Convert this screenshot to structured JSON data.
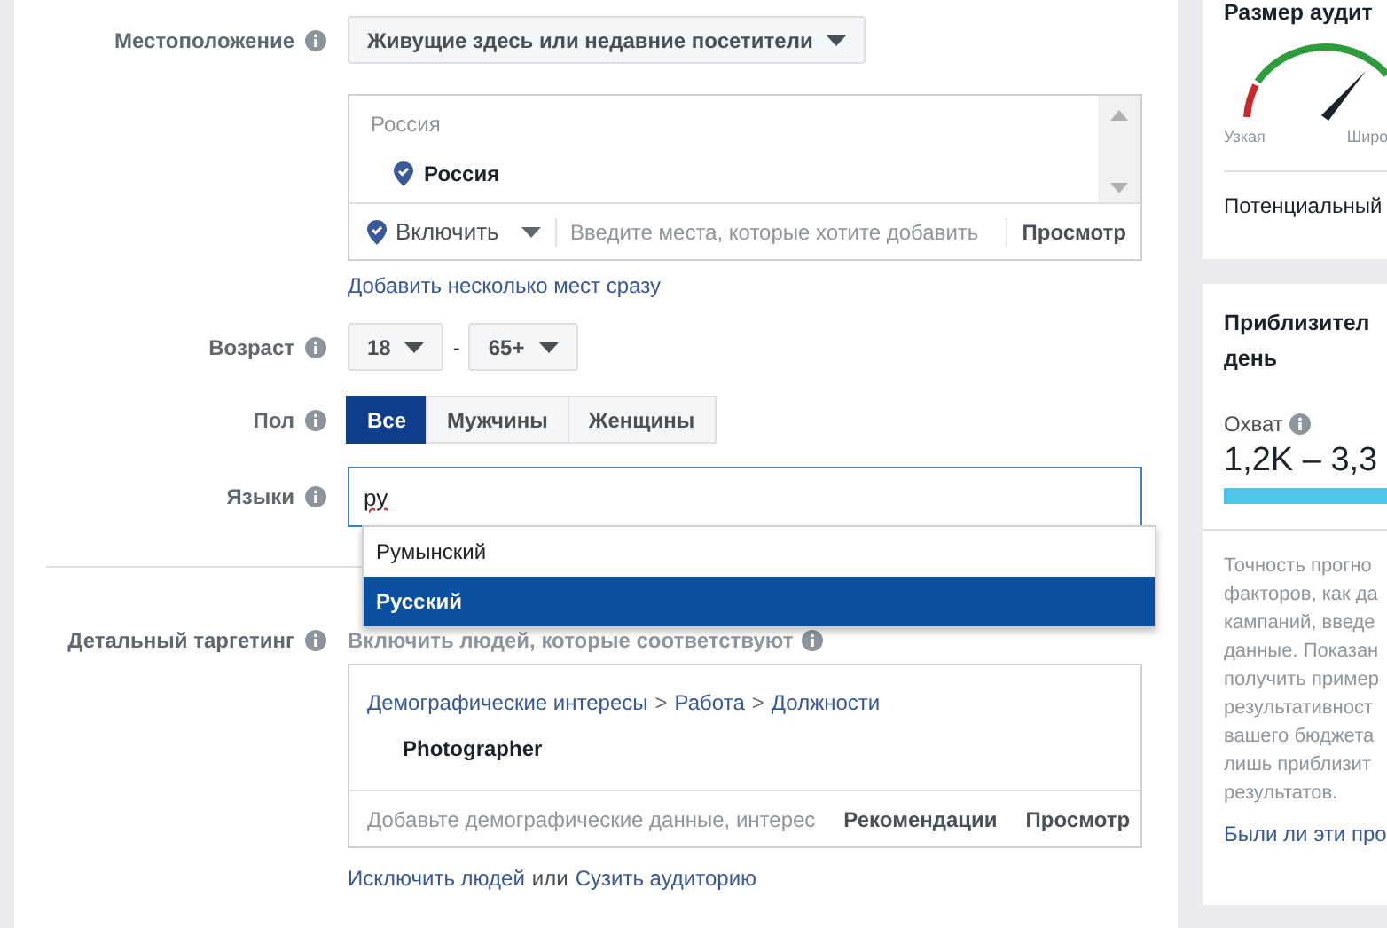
{
  "location": {
    "label": "Местоположение",
    "mode": "Живущие здесь или недавние посетители",
    "group_title": "Россия",
    "places": [
      {
        "name": "Россия"
      }
    ],
    "include": "Включить",
    "placeholder": "Введите места, которые хотите добавить",
    "browse": "Просмотр",
    "bulk_link": "Добавить несколько мест сразу"
  },
  "age": {
    "label": "Возраст",
    "min": "18",
    "separator": "-",
    "max": "65+"
  },
  "gender": {
    "label": "Пол",
    "options": [
      {
        "label": "Все",
        "selected": true
      },
      {
        "label": "Мужчины",
        "selected": false
      },
      {
        "label": "Женщины",
        "selected": false
      }
    ]
  },
  "languages": {
    "label": "Языки",
    "value": "ру",
    "suggestions": [
      {
        "label": "Румынский",
        "selected": false
      },
      {
        "label": "Русский",
        "selected": true
      }
    ]
  },
  "detailed": {
    "label": "Детальный таргетинг",
    "caption": "Включить людей, которые соответствуют",
    "path": [
      "Демографические интересы",
      "Работа",
      "Должности"
    ],
    "path_separator": ">",
    "item": "Photographer",
    "placeholder": "Добавьте демографические данные, интерес",
    "suggestions": "Рекомендации",
    "browse": "Просмотр",
    "exclude_link": "Исключить людей",
    "or": "или",
    "narrow_link": "Сузить аудиторию"
  },
  "audience_size": {
    "title": "Размер аудит",
    "narrow": "Узкая",
    "broad": "Широ",
    "potential": "Потенциальный"
  },
  "estimate": {
    "title_lines": [
      "Приблизител",
      "день"
    ],
    "reach_label": "Охват",
    "reach": "1,2K – 3,3",
    "note_lines": [
      "Точность прогно",
      "факторов, как да",
      "кампаний, введе",
      "данные. Показан",
      "получить пример",
      "результативност",
      "вашего бюджета",
      "лишь приблизит",
      "результатов."
    ],
    "feedback_link": "Были ли эти про"
  }
}
